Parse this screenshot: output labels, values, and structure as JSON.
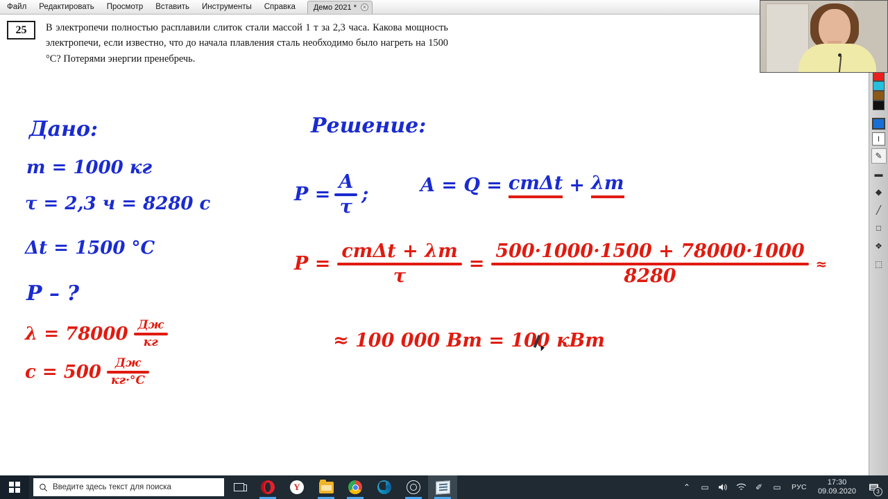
{
  "menu": {
    "items": [
      {
        "label": "Файл",
        "name": "menu-file"
      },
      {
        "label": "Редактировать",
        "name": "menu-edit"
      },
      {
        "label": "Просмотр",
        "name": "menu-view"
      },
      {
        "label": "Вставить",
        "name": "menu-insert"
      },
      {
        "label": "Инструменты",
        "name": "menu-tools"
      },
      {
        "label": "Справка",
        "name": "menu-help"
      }
    ],
    "tab": {
      "title": "Демо 2021 *",
      "close_glyph": "×"
    },
    "right_buttons": [
      {
        "name": "window-restore-button",
        "glyph": "▣"
      },
      {
        "name": "account-button",
        "glyph": "●"
      }
    ]
  },
  "document": {
    "problem_number": "25",
    "problem_text": "В электропечи полностью расплавили слиток стали массой 1 т за 2,3 часа. Какова мощность электропечи, если известно, что до начала плавления сталь необходимо было нагреть на 1500 °C? Потерями энергии пренебречь."
  },
  "handwriting": {
    "given_heading": "Дано:",
    "given": [
      {
        "name": "given-mass",
        "text": "m = 1000 кг"
      },
      {
        "name": "given-time",
        "text": "τ = 2,3 ч = 8280 с"
      },
      {
        "name": "given-delta-t",
        "text": "Δt = 1500 °C"
      },
      {
        "name": "find-power",
        "text": "P – ?"
      }
    ],
    "constants": {
      "lambda_label": "λ = 78000",
      "lambda_num": "Дж",
      "lambda_den": "кг",
      "c_label": "c = 500",
      "c_num": "Дж",
      "c_den": "кг·°C"
    },
    "solution_heading": "Решение:",
    "formula_power_lhs": "P =",
    "formula_power_num": "A",
    "formula_power_den": "τ",
    "formula_semicolon": ";",
    "formula_work": "A = Q =",
    "formula_work_cmdt": "cmΔt",
    "formula_work_plus": "+",
    "formula_work_lm": "λm",
    "calc_lhs": "P =",
    "calc_num": "cmΔt + λm",
    "calc_den": "τ",
    "calc_eq": "=",
    "calc_sub_num": "500·1000·1500 + 78000·1000",
    "calc_sub_den": "8280",
    "calc_approx": "≈",
    "answer": "≈ 100 000 Вт = 100 кВт"
  },
  "toolstrip": {
    "palette": [
      {
        "name": "swatch-red",
        "color": "#e8201c"
      },
      {
        "name": "swatch-cyan",
        "color": "#28bede"
      },
      {
        "name": "swatch-brown",
        "color": "#8a5a16"
      },
      {
        "name": "swatch-black",
        "color": "#111111"
      }
    ],
    "current_color": "#1a6fd4",
    "current_color_name": "current-color-indicator",
    "tools": [
      {
        "name": "text-tool",
        "glyph": "I"
      },
      {
        "name": "pencil-tool",
        "glyph": "✎"
      },
      {
        "name": "eraser-tool",
        "glyph": "▬"
      },
      {
        "name": "fill-tool",
        "glyph": "◆"
      },
      {
        "name": "line-tool",
        "glyph": "╱"
      },
      {
        "name": "shape-tool",
        "glyph": "□"
      },
      {
        "name": "stamp-tool",
        "glyph": "❖"
      },
      {
        "name": "select-tool",
        "glyph": "⬚"
      }
    ]
  },
  "taskbar": {
    "search_placeholder": "Введите здесь текст для поиска",
    "search_icon": "search-icon",
    "start_name": "start-button",
    "task_view_name": "task-view-button",
    "apps": [
      {
        "name": "taskbar-opera",
        "icon": "opera-icon",
        "running": true,
        "active": false
      },
      {
        "name": "taskbar-yandex",
        "icon": "yandex-icon",
        "running": false,
        "active": false
      },
      {
        "name": "taskbar-explorer",
        "icon": "folder-icon",
        "running": true,
        "active": false
      },
      {
        "name": "taskbar-chrome",
        "icon": "chrome-icon",
        "running": true,
        "active": false
      },
      {
        "name": "taskbar-edge",
        "icon": "edge-icon",
        "running": false,
        "active": false
      },
      {
        "name": "taskbar-obs",
        "icon": "obs-icon",
        "running": true,
        "active": false
      },
      {
        "name": "taskbar-whiteboard",
        "icon": "paint-icon",
        "running": true,
        "active": true
      }
    ],
    "tray": {
      "chevron": "⌃",
      "battery": "▭",
      "volume": "◂",
      "wifi": "◠",
      "pen": "✐",
      "touch": "▭",
      "language": "РУС",
      "time": "17:30",
      "date": "09.09.2020",
      "notification_count": "3"
    }
  }
}
